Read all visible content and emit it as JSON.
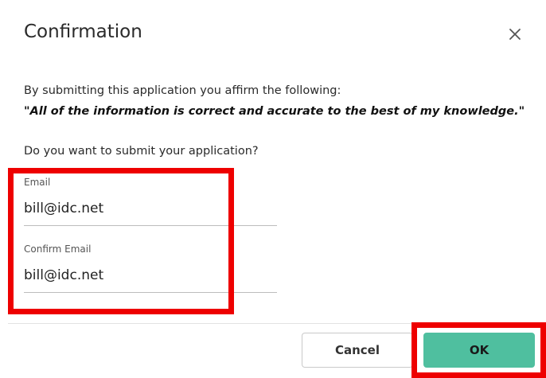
{
  "dialog": {
    "title": "Confirmation",
    "close_icon": "close-icon",
    "affirm_intro": "By submitting this application you affirm the following:",
    "affirm_statement": "\"All of the information is correct and accurate to the best of my knowledge.\"",
    "question": "Do you want to submit your application?"
  },
  "form": {
    "email": {
      "label": "Email",
      "value": "bill@idc.net"
    },
    "confirm_email": {
      "label": "Confirm Email",
      "value": "bill@idc.net"
    }
  },
  "actions": {
    "cancel_label": "Cancel",
    "ok_label": "OK"
  },
  "colors": {
    "ok_button": "#4fbf9f",
    "highlight": "#ee0000"
  }
}
